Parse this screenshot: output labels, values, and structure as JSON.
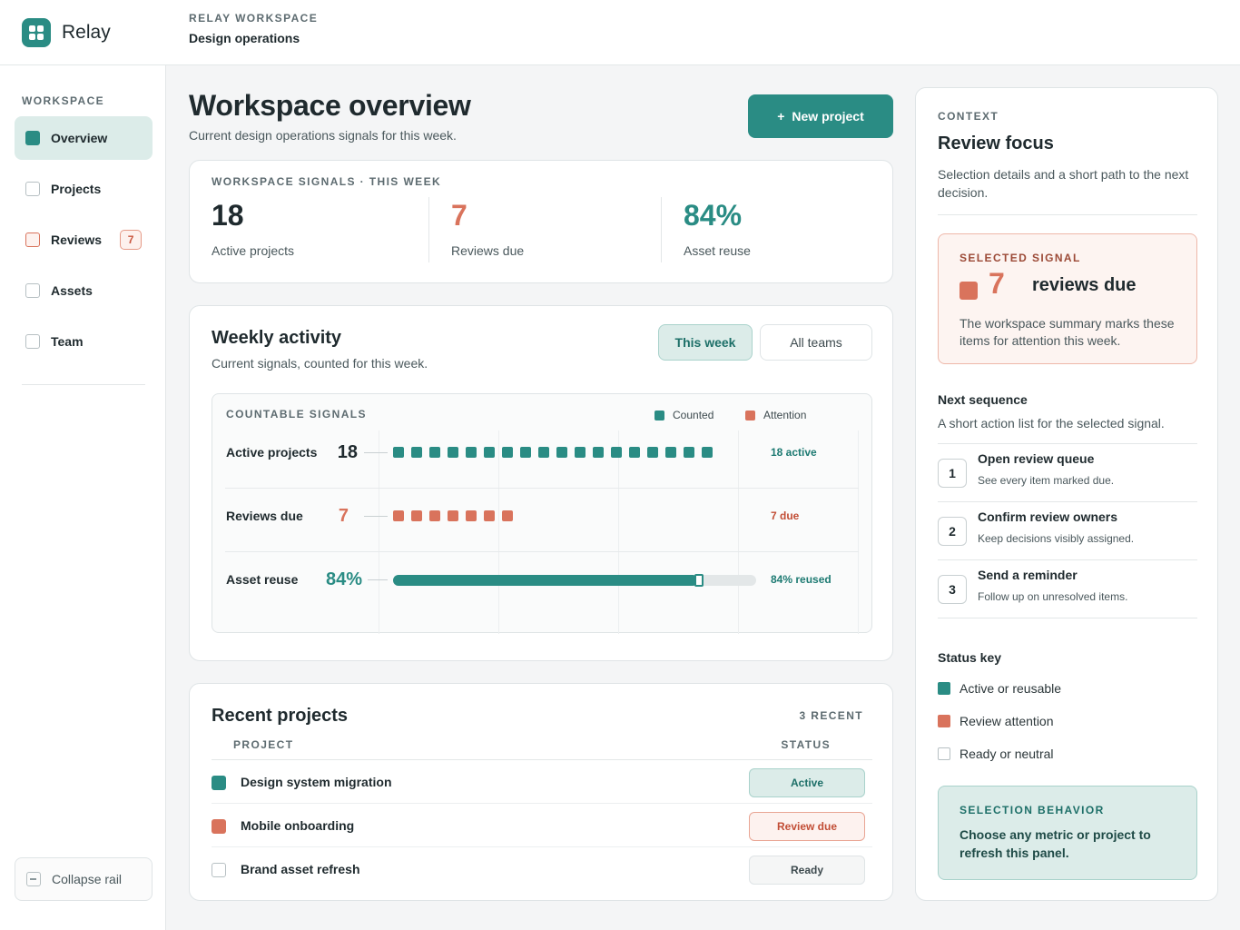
{
  "brand": {
    "name": "Relay"
  },
  "header": {
    "eyebrow": "RELAY WORKSPACE",
    "title": "Design operations"
  },
  "sidebar": {
    "eyebrow": "WORKSPACE",
    "items": [
      {
        "label": "Overview",
        "active": true
      },
      {
        "label": "Projects"
      },
      {
        "label": "Reviews",
        "badge": "7"
      },
      {
        "label": "Assets"
      },
      {
        "label": "Team"
      }
    ],
    "collapse_label": "Collapse rail"
  },
  "main": {
    "title": "Workspace overview",
    "subtitle": "Current design operations signals for this week.",
    "new_project_label": "New project"
  },
  "signals": {
    "eyebrow": "WORKSPACE SIGNALS · THIS WEEK",
    "metrics": [
      {
        "value": "18",
        "label": "Active projects"
      },
      {
        "value": "7",
        "label": "Reviews due"
      },
      {
        "value": "84%",
        "label": "Asset reuse"
      }
    ]
  },
  "activity": {
    "title": "Weekly activity",
    "subtitle": "Current signals, counted for this week.",
    "chips": [
      "This week",
      "All teams"
    ],
    "panel_eyebrow": "COUNTABLE SIGNALS",
    "legend": [
      "Counted",
      "Attention"
    ]
  },
  "chart_data": {
    "type": "bar",
    "title": "",
    "legend": [
      "Counted",
      "Attention"
    ],
    "rows": [
      {
        "label": "Active projects",
        "display": "18",
        "value": 18,
        "kind": "count",
        "series": "Counted",
        "note": "18 active"
      },
      {
        "label": "Reviews due",
        "display": "7",
        "value": 7,
        "kind": "count",
        "series": "Attention",
        "note": "7 due"
      },
      {
        "label": "Asset reuse",
        "display": "84%",
        "value": 84,
        "kind": "percent",
        "series": "Counted",
        "note": "84% reused",
        "max": 100
      }
    ]
  },
  "recent": {
    "title": "Recent projects",
    "count_label": "3 RECENT",
    "col_project": "PROJECT",
    "col_status": "STATUS",
    "rows": [
      {
        "name": "Design system migration",
        "status": "Active",
        "kind": "active"
      },
      {
        "name": "Mobile onboarding",
        "status": "Review due",
        "kind": "due"
      },
      {
        "name": "Brand asset refresh",
        "status": "Ready",
        "kind": "ready"
      }
    ]
  },
  "context": {
    "eyebrow": "CONTEXT",
    "title": "Review focus",
    "desc": "Selection details and a short path to the next decision.",
    "selected": {
      "eyebrow": "SELECTED SIGNAL",
      "value": "7",
      "label": "reviews due",
      "desc": "The workspace summary marks these items for attention this week."
    },
    "sequence_title": "Next sequence",
    "sequence_desc": "A short action list for the selected signal.",
    "steps": [
      {
        "num": "1",
        "title": "Open review queue",
        "sub": "See every item marked due."
      },
      {
        "num": "2",
        "title": "Confirm review owners",
        "sub": "Keep decisions visibly assigned."
      },
      {
        "num": "3",
        "title": "Send a reminder",
        "sub": "Follow up on unresolved items."
      }
    ],
    "status_key_title": "Status key",
    "status_key": [
      "Active or reusable",
      "Review attention",
      "Ready or neutral"
    ],
    "behavior": {
      "eyebrow": "SELECTION BEHAVIOR",
      "desc": "Choose any metric or project to refresh this panel."
    }
  },
  "colors": {
    "teal": "#2a8c84",
    "coral": "#d9735c",
    "neutral": "#ffffff"
  }
}
